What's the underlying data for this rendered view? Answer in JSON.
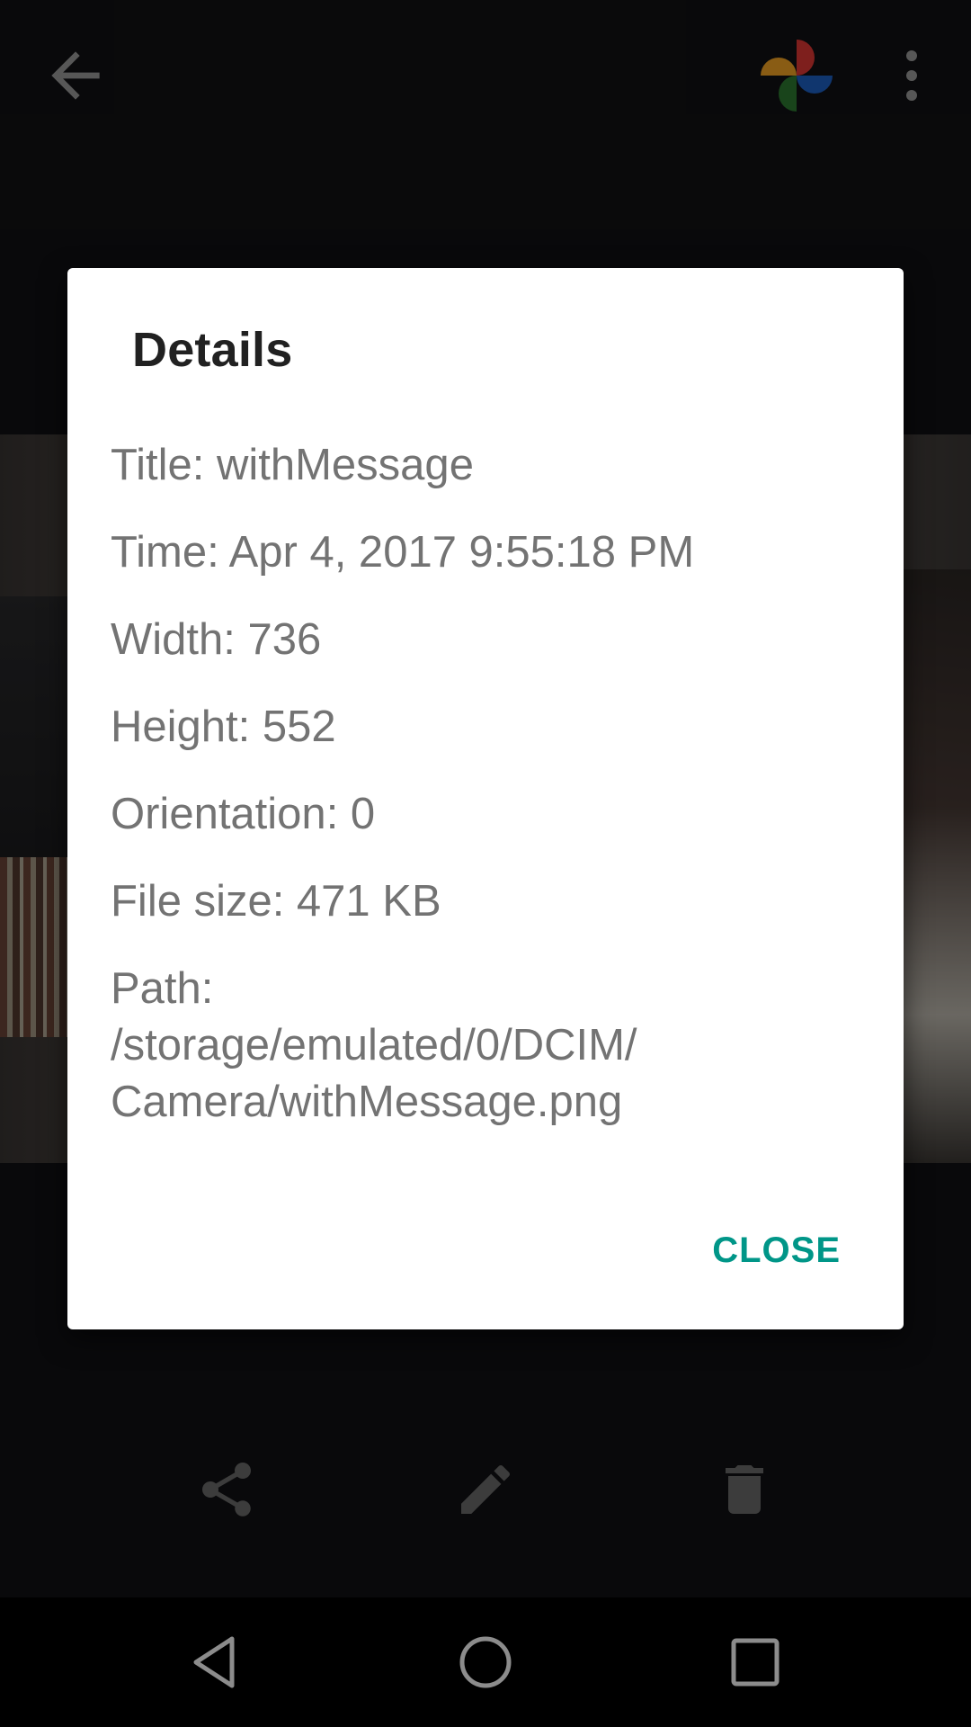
{
  "dialog": {
    "title": "Details",
    "items": {
      "title": "Title: withMessage",
      "time": "Time: Apr 4, 2017 9:55:18 PM",
      "width": "Width: 736",
      "height": "Height: 552",
      "orientation": "Orientation: 0",
      "file_size": "File size: 471 KB",
      "path_label": "Path:",
      "path_line1": "/storage/emulated/0/DCIM/",
      "path_line2": "Camera/withMessage.png"
    },
    "close_label": "CLOSE"
  },
  "icons": {
    "back": "arrow-back-icon",
    "logo": "google-photos-pinwheel-icon",
    "overflow": "more-vert-icon",
    "share": "share-icon",
    "edit": "pencil-icon",
    "delete": "trash-icon",
    "nav_back": "triangle-back-icon",
    "nav_home": "circle-home-icon",
    "nav_recents": "square-recents-icon"
  },
  "colors": {
    "accent": "#009688",
    "dialog_bg": "#ffffff",
    "title_text": "#212121",
    "body_text": "#737373",
    "background": "#121214"
  }
}
